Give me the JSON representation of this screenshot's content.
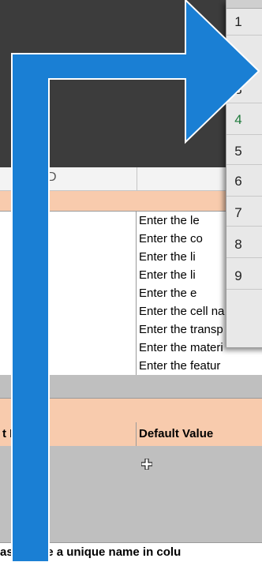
{
  "column_header": {
    "label": "D"
  },
  "popup_rows": [
    "1",
    "",
    "3",
    "4",
    "5",
    "6",
    "7",
    "8",
    "9"
  ],
  "rows": [
    {
      "colB": "Enter the le"
    },
    {
      "colB": "Enter the co"
    },
    {
      "colB": "Enter the li"
    },
    {
      "colB": "Enter the li"
    },
    {
      "colB": "Enter the e"
    },
    {
      "colB": "Enter the cell na"
    },
    {
      "colB": "Enter the transp"
    },
    {
      "colB": "Enter the materi"
    },
    {
      "colB": "Enter the featur"
    }
  ],
  "header_row": {
    "colA": "t L",
    "colB": "Default Value"
  },
  "footer_text": "as      y have a unique name in colu",
  "colors": {
    "arrow": "#1a7fd4",
    "salmon": "#f8cbad",
    "gray_band": "#bfbfbf",
    "active_row": "#1f7a3c"
  },
  "icons": {
    "arrow": "turn-right-arrow-icon",
    "cursor": "cross-cursor-icon"
  }
}
